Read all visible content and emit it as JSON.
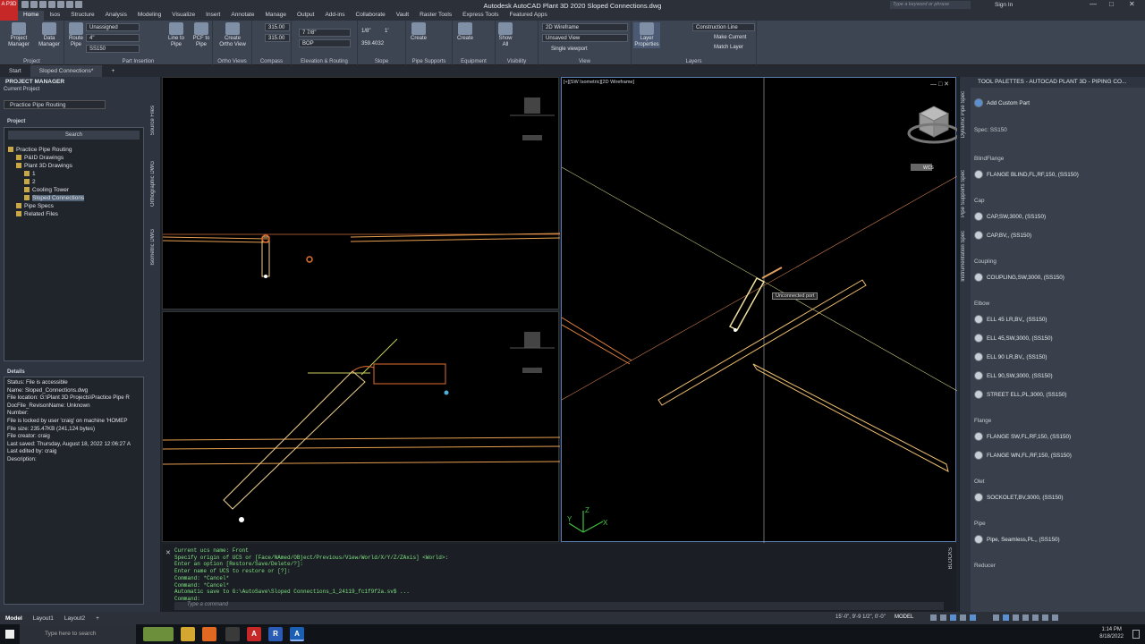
{
  "window": {
    "title": "Autodesk AutoCAD Plant 3D 2020    Sloped Connections.dwg",
    "search_placeholder": "Type a keyword or phrase",
    "signin": "Sign In",
    "app_letter": "A P3D"
  },
  "ribbon_tabs": [
    "Home",
    "Isos",
    "Structure",
    "Analysis",
    "Modeling",
    "Visualize",
    "Insert",
    "Annotate",
    "Manage",
    "Output",
    "Add-ins",
    "Collaborate",
    "Vault",
    "Raster Tools",
    "Express Tools",
    "Featured Apps"
  ],
  "ribbon": {
    "project_manager": "Project\nManager",
    "data_manager": "Data\nManager",
    "route_pipe": "Route\nPipe",
    "line_to_pipe": "Line to\nPipe",
    "pcf_to_pipe": "PCF to\nPipe",
    "create_ortho": "Create\nOrtho View",
    "unassigned": "Unassigned",
    "size": "4\"",
    "spec": "SS150",
    "elev1": "315.00",
    "elev2": "315.00",
    "elev_val": "7 7/8\"",
    "bop": "BOP",
    "slope1": "1/8\"",
    "slope2": "1'",
    "slope_val": "359.4032",
    "create1": "Create",
    "create2": "Create",
    "show_all": "Show\nAll",
    "visual_style": "2D Wireframe",
    "unsaved_view": "Unsaved View",
    "single_viewport": "Single viewport",
    "layer_props": "Layer\nProperties",
    "layer_name": "Construction Line",
    "make_current": "Make Current",
    "match_layer": "Match Layer",
    "panels": [
      "Project",
      "Part Insertion",
      "Ortho Views",
      "Compass",
      "Elevation & Routing",
      "Slope",
      "Pipe Supports",
      "Equipment",
      "Visibility",
      "View",
      "Layers"
    ]
  },
  "file_tabs": [
    "Start",
    "Sloped Connections*"
  ],
  "project_manager": {
    "title": "PROJECT MANAGER",
    "current_project_label": "Current Project",
    "current_project": "Practice Pipe Routing",
    "project_label": "Project",
    "search": "Search",
    "tree": [
      {
        "label": "Practice Pipe Routing",
        "level": 0
      },
      {
        "label": "P&ID Drawings",
        "level": 1
      },
      {
        "label": "Plant 3D Drawings",
        "level": 1
      },
      {
        "label": "1",
        "level": 2
      },
      {
        "label": "2",
        "level": 2
      },
      {
        "label": "Cooling Tower",
        "level": 2
      },
      {
        "label": "Sloped Connections",
        "level": 2,
        "selected": true
      },
      {
        "label": "Pipe Specs",
        "level": 1
      },
      {
        "label": "Related Files",
        "level": 1
      }
    ],
    "details_label": "Details",
    "details": [
      "Status: File is accessible",
      "Name: Sloped_Connections.dwg",
      "File location: G:\\Plant 3D Projects\\Practice Pipe R",
      "DocFile_RevisonName: Unknown",
      "Number:",
      "File is locked by user 'craig' on machine 'HOMEP",
      "File size: 235.47KB (241,124 bytes)",
      "File creator: craig",
      "Last saved: Thursday, August 18, 2022 12:06:27 A",
      "Last edited by: craig",
      "Description:"
    ],
    "side_tabs": [
      "Source Files",
      "Orthographic DWG",
      "Isometric DWG"
    ]
  },
  "viewport": {
    "label": "[+][SW Isometric][2D Wireframe]",
    "tooltip": "Unconnected port",
    "wcs": "WCS"
  },
  "command_lines": [
    "Current ucs name:  Front",
    "Specify origin of UCS or [Face/NAmed/OBject/Previous/View/World/X/Y/Z/ZAxis] <World>:",
    "Enter an option [Restore/Save/Delete/?]:",
    "Enter name of UCS to restore or [?]:",
    "Command: *Cancel*",
    "Command: *Cancel*",
    "Automatic save to G:\\AutoSave\\Sloped Connections_1_24119_fc1f9f2a.sv$ ...",
    "Command:"
  ],
  "command_placeholder": "Type a command",
  "tool_palette": {
    "title": "TOOL PALETTES - AUTOCAD PLANT 3D - PIPING CO...",
    "side_tabs": [
      "Dynamic Pipe Spec",
      "Pipe Supports Spec",
      "Instrumentation Spec"
    ],
    "add_custom": "Add Custom Part",
    "spec": "Spec: SS150",
    "items": [
      {
        "cat": "BlindFlange"
      },
      {
        "part": "FLANGE BLIND,FL,RF,150, (SS150)"
      },
      {
        "cat": "Cap"
      },
      {
        "part": "CAP,SW,3000, (SS150)"
      },
      {
        "part": "CAP,BV,, (SS150)"
      },
      {
        "cat": "Coupling"
      },
      {
        "part": "COUPLING,SW,3000, (SS150)"
      },
      {
        "cat": "Elbow"
      },
      {
        "part": "ELL 45 LR,BV,, (SS150)"
      },
      {
        "part": "ELL 45,SW,3000, (SS150)"
      },
      {
        "part": "ELL 90 LR,BV,, (SS150)"
      },
      {
        "part": "ELL 90,SW,3000, (SS150)"
      },
      {
        "part": "STREET ELL,PL,3000, (SS150)"
      },
      {
        "cat": "Flange"
      },
      {
        "part": "FLANGE SW,FL,RF,150, (SS150)"
      },
      {
        "part": "FLANGE WN,FL,RF,150, (SS150)"
      },
      {
        "cat": "Olet"
      },
      {
        "part": "SOCKOLET,BV,3000, (SS150)"
      },
      {
        "cat": "Pipe"
      },
      {
        "part": "Pipe, Seamless,PL,, (SS150)"
      },
      {
        "cat": "Reducer"
      }
    ]
  },
  "status": {
    "tabs": [
      "Model",
      "Layout1",
      "Layout2"
    ],
    "coords": "15'-0\", 9'-9 1/2\", 0'-0\"",
    "model": "MODEL",
    "blocks": "BLOCKS"
  },
  "taskbar": {
    "search": "Type here to search",
    "time": "1:14 PM",
    "date": "8/18/2022"
  }
}
